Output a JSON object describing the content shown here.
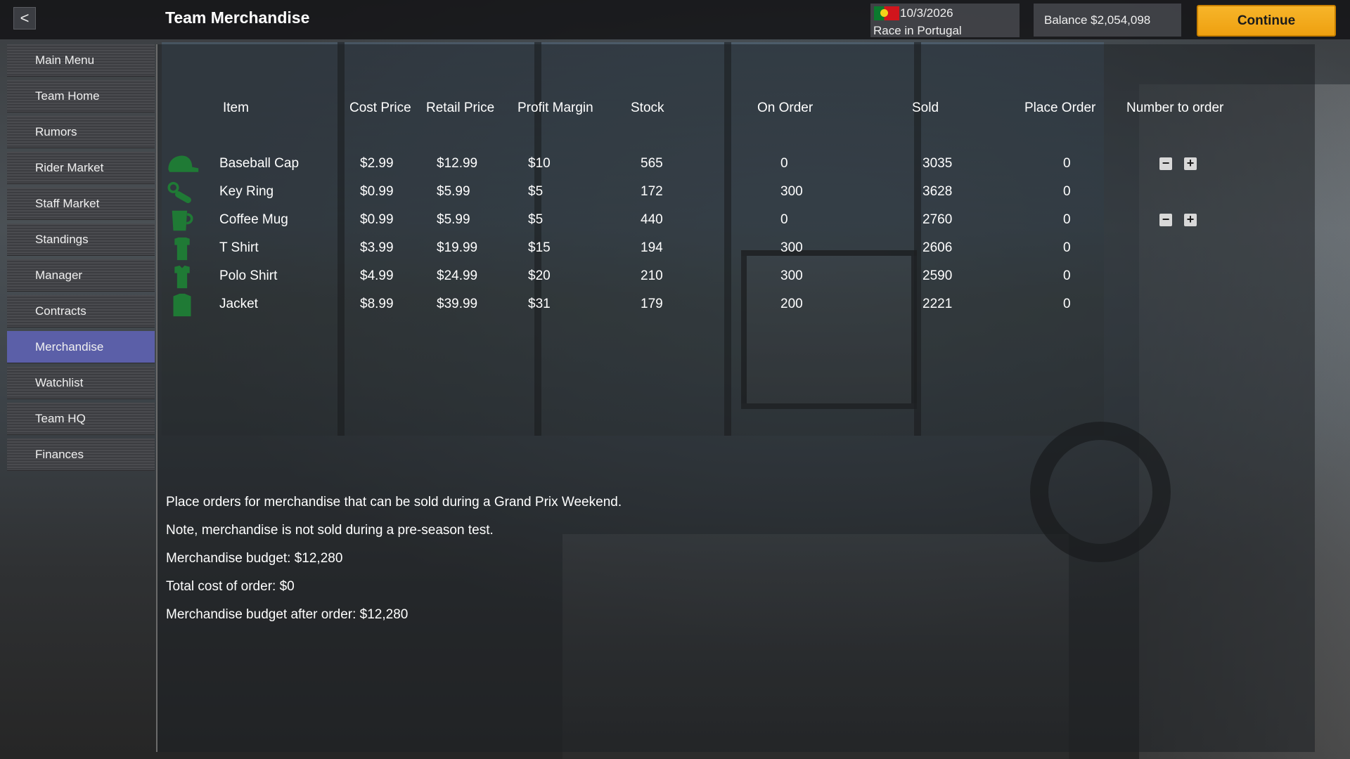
{
  "header": {
    "back_label": "<",
    "title": "Team Merchandise",
    "date": "10/3/2026",
    "next_event": "Race in Portugal",
    "balance": "Balance $2,054,098",
    "continue_label": "Continue",
    "flag_icon": "portugal-flag-icon"
  },
  "sidebar": {
    "items": [
      {
        "label": "Main Menu"
      },
      {
        "label": "Team Home"
      },
      {
        "label": "Rumors"
      },
      {
        "label": "Rider Market"
      },
      {
        "label": "Staff Market"
      },
      {
        "label": "Standings"
      },
      {
        "label": "Manager"
      },
      {
        "label": "Contracts"
      },
      {
        "label": "Merchandise"
      },
      {
        "label": "Watchlist"
      },
      {
        "label": "Team HQ"
      },
      {
        "label": "Finances"
      }
    ],
    "active": "Merchandise",
    "active_color": "#5b5fa8"
  },
  "table": {
    "headers": {
      "item": "Item",
      "cost": "Cost Price",
      "retail": "Retail Price",
      "margin": "Profit Margin",
      "stock": "Stock",
      "on_order": "On Order",
      "sold": "Sold",
      "place_order": "Place Order",
      "number_to_order": "Number to order"
    },
    "rows": [
      {
        "name": "Baseball Cap",
        "icon": "cap-icon",
        "cost": "$2.99",
        "retail": "$12.99",
        "margin": "$10",
        "stock": "565",
        "on_order": "0",
        "sold": "3035",
        "place_order": "0",
        "stepper": true
      },
      {
        "name": "Key Ring",
        "icon": "key-ring-icon",
        "cost": "$0.99",
        "retail": "$5.99",
        "margin": "$5",
        "stock": "172",
        "on_order": "300",
        "sold": "3628",
        "place_order": "0",
        "stepper": false
      },
      {
        "name": "Coffee Mug",
        "icon": "mug-icon",
        "cost": "$0.99",
        "retail": "$5.99",
        "margin": "$5",
        "stock": "440",
        "on_order": "0",
        "sold": "2760",
        "place_order": "0",
        "stepper": true
      },
      {
        "name": "T Shirt",
        "icon": "t-shirt-icon",
        "cost": "$3.99",
        "retail": "$19.99",
        "margin": "$15",
        "stock": "194",
        "on_order": "300",
        "sold": "2606",
        "place_order": "0",
        "stepper": false
      },
      {
        "name": "Polo Shirt",
        "icon": "polo-shirt-icon",
        "cost": "$4.99",
        "retail": "$24.99",
        "margin": "$20",
        "stock": "210",
        "on_order": "300",
        "sold": "2590",
        "place_order": "0",
        "stepper": false
      },
      {
        "name": "Jacket",
        "icon": "jacket-icon",
        "cost": "$8.99",
        "retail": "$39.99",
        "margin": "$31",
        "stock": "179",
        "on_order": "200",
        "sold": "2221",
        "place_order": "0",
        "stepper": false
      }
    ],
    "stepper_minus": "−",
    "stepper_plus": "+",
    "icon_color": "#1f7a35"
  },
  "info": {
    "line1": "Place orders for merchandise that can be sold during a Grand Prix Weekend.",
    "line2": "Note, merchandise is not sold during a pre-season test.",
    "line3": "Merchandise budget: $12,280",
    "line4": "Total cost of order: $0",
    "line5": "Merchandise budget after order: $12,280"
  }
}
